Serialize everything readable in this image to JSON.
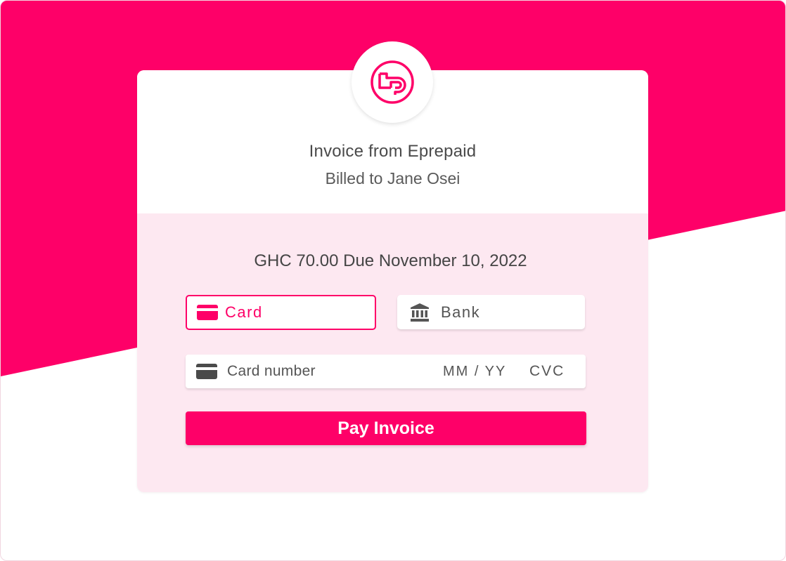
{
  "colors": {
    "accent": "#fe0068",
    "panel_tint": "#fde8f1",
    "text_dark": "#454545"
  },
  "logo": {
    "icon": "eprepaid-logo-icon"
  },
  "invoice": {
    "title": "Invoice from Eprepaid",
    "billed_to": "Billed to Jane Osei",
    "amount_due": "GHC 70.00 Due November 10, 2022"
  },
  "payment_methods": {
    "tabs": [
      {
        "label": "Card",
        "icon": "credit-card-icon",
        "selected": true
      },
      {
        "label": "Bank",
        "icon": "bank-icon",
        "selected": false
      }
    ]
  },
  "card_form": {
    "card_number_placeholder": "Card number",
    "expiry_placeholder": "MM / YY",
    "cvc_placeholder": "CVC",
    "icon": "credit-card-icon"
  },
  "actions": {
    "pay_label": "Pay Invoice"
  }
}
